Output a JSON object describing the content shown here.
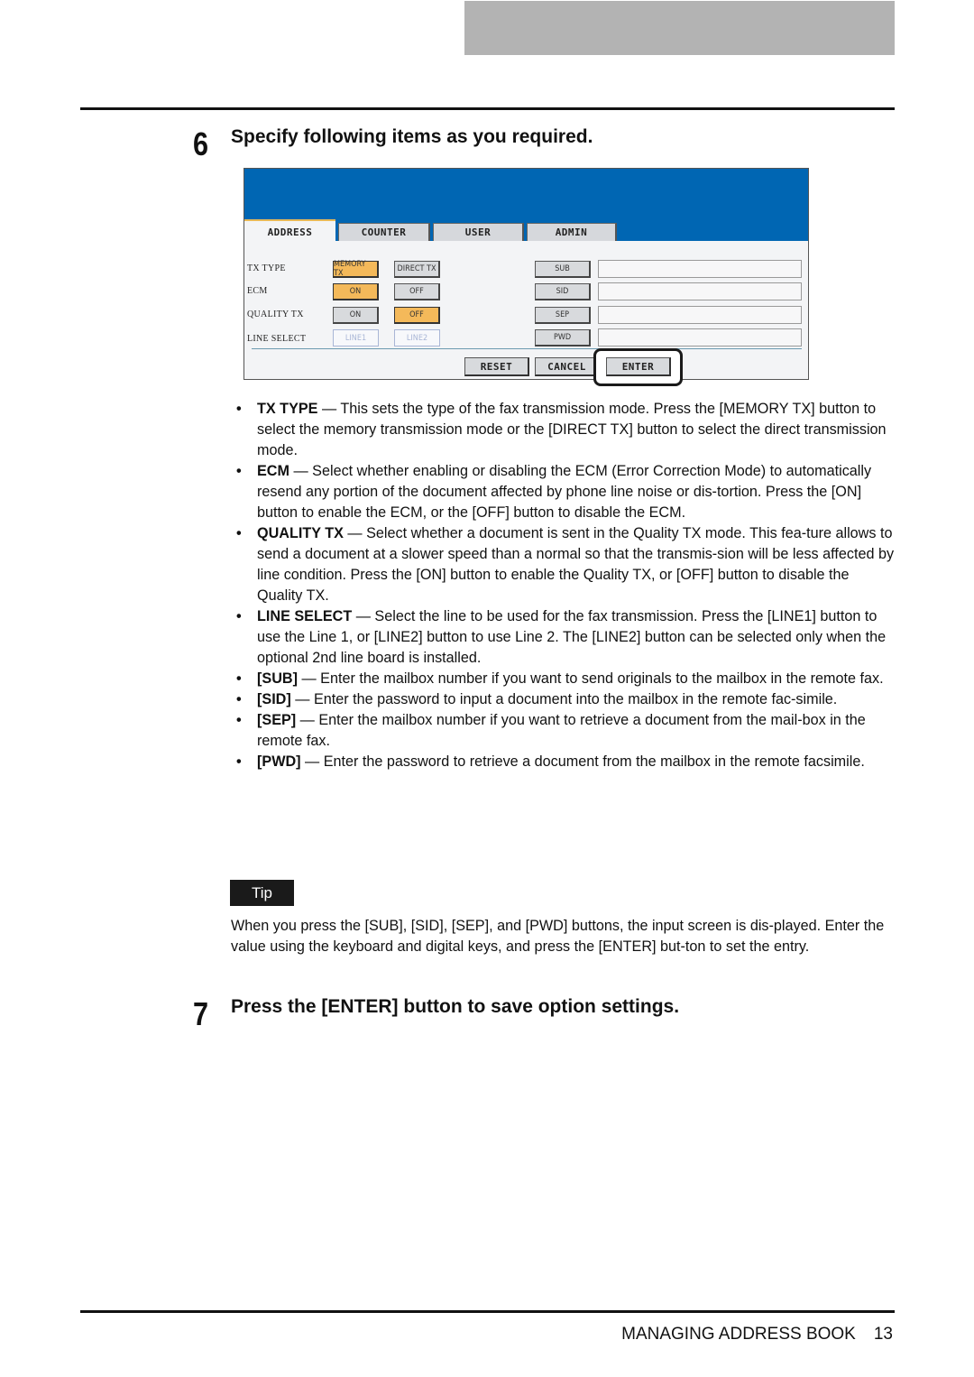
{
  "steps": {
    "step6": {
      "number": "6",
      "title": "Specify following items as you required."
    },
    "step7": {
      "number": "7",
      "title": "Press the [ENTER] button to save option settings."
    }
  },
  "panel": {
    "tabs": [
      {
        "label": "ADDRESS",
        "active": true
      },
      {
        "label": "COUNTER",
        "active": false
      },
      {
        "label": "USER",
        "active": false
      },
      {
        "label": "ADMIN",
        "active": false
      }
    ],
    "rows": [
      {
        "label": "TX TYPE",
        "options": [
          {
            "label": "MEMORY TX",
            "selected": true
          },
          {
            "label": "DIRECT TX",
            "selected": false
          }
        ]
      },
      {
        "label": "ECM",
        "options": [
          {
            "label": "ON",
            "selected": true
          },
          {
            "label": "OFF",
            "selected": false
          }
        ]
      },
      {
        "label": "QUALITY TX",
        "options": [
          {
            "label": "ON",
            "selected": false
          },
          {
            "label": "OFF",
            "selected": true
          }
        ]
      },
      {
        "label": "LINE SELECT",
        "options": [
          {
            "label": "LINE1",
            "selected": false,
            "disabled": true
          },
          {
            "label": "LINE2",
            "selected": false,
            "disabled": true
          }
        ]
      }
    ],
    "fields": [
      {
        "button": "SUB",
        "value": ""
      },
      {
        "button": "SID",
        "value": ""
      },
      {
        "button": "SEP",
        "value": ""
      },
      {
        "button": "PWD",
        "value": ""
      }
    ],
    "actions": {
      "reset": "RESET",
      "cancel": "CANCEL",
      "enter": "ENTER"
    },
    "colors": {
      "header": "#0066b3",
      "selected": "#f4b95a",
      "button": "#d8dadd"
    }
  },
  "bullets": [
    {
      "term": "TX TYPE",
      "text": " — This sets the type of the fax transmission mode.  Press the [MEMORY TX] button to select the memory transmission mode or the [DIRECT TX] button to select the direct transmission mode."
    },
    {
      "term": "ECM",
      "text": " — Select whether enabling or disabling the ECM (Error Correction Mode) to automatically resend any portion of the document affected by phone line noise or dis-tortion.  Press the [ON] button to enable the ECM, or the [OFF] button to disable the ECM."
    },
    {
      "term": "QUALITY TX",
      "text": " — Select whether a document is sent in the Quality TX mode. This fea-ture allows to send a document at a slower speed than a normal so that the transmis-sion will be less affected by line condition.  Press the [ON] button to enable the Quality TX, or [OFF] button to disable the Quality TX."
    },
    {
      "term": "LINE SELECT",
      "text": " — Select the line to be used for the fax transmission.  Press the [LINE1] button to use the Line 1, or [LINE2] button to use Line 2.  The [LINE2] button can be selected only when the optional 2nd line board is installed."
    },
    {
      "term": "[SUB]",
      "text": " — Enter the mailbox number if you want to send originals to the mailbox in the remote fax."
    },
    {
      "term": "[SID]",
      "text": " — Enter the password to input a document into the mailbox in the remote fac-simile."
    },
    {
      "term": "[SEP]",
      "text": " — Enter the mailbox number if you want to retrieve a document from the mail-box in the remote fax."
    },
    {
      "term": "[PWD]",
      "text": " — Enter the password to retrieve a document from the mailbox in the remote facsimile."
    }
  ],
  "tip": {
    "label": "Tip",
    "text": "When you press the [SUB], [SID], [SEP], and [PWD] buttons, the input screen is dis-played.  Enter the value using the keyboard and digital keys, and press the [ENTER] but-ton to set the entry."
  },
  "footer": {
    "section": "MANAGING ADDRESS BOOK",
    "page": "13"
  }
}
